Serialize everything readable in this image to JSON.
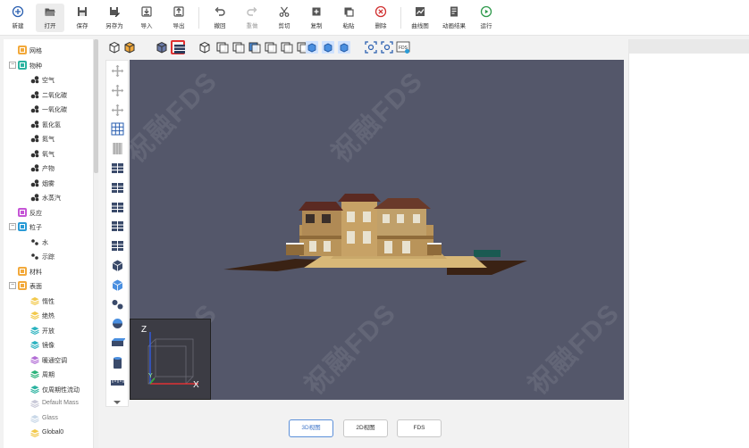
{
  "toolbar": {
    "items": [
      {
        "label": "新建",
        "icon": "plus-circle-icon"
      },
      {
        "label": "打开",
        "icon": "folder-open-icon"
      },
      {
        "label": "保存",
        "icon": "save-icon"
      },
      {
        "label": "另存为",
        "icon": "save-as-icon"
      },
      {
        "label": "导入",
        "icon": "import-icon"
      },
      {
        "label": "导出",
        "icon": "export-icon"
      },
      {
        "label": "撤回",
        "icon": "undo-icon"
      },
      {
        "label": "重做",
        "icon": "redo-icon"
      },
      {
        "label": "剪切",
        "icon": "scissors-icon"
      },
      {
        "label": "复制",
        "icon": "copy-icon"
      },
      {
        "label": "粘贴",
        "icon": "paste-icon"
      },
      {
        "label": "删除",
        "icon": "delete-icon"
      },
      {
        "label": "曲线图",
        "icon": "line-chart-icon"
      },
      {
        "label": "动画结果",
        "icon": "animation-result-icon"
      },
      {
        "label": "运行",
        "icon": "play-circle-icon"
      }
    ]
  },
  "tree": {
    "items": [
      {
        "label": "网格",
        "level": 0,
        "icon": "grid-icon",
        "color": "#f2a93b"
      },
      {
        "label": "物种",
        "level": 0,
        "icon": "species-icon",
        "color": "#2bb3a0",
        "expanded": true
      },
      {
        "label": "空气",
        "level": 1,
        "icon": "molecule-icon"
      },
      {
        "label": "二氧化碳",
        "level": 1,
        "icon": "molecule-icon"
      },
      {
        "label": "一氧化碳",
        "level": 1,
        "icon": "molecule-icon"
      },
      {
        "label": "氰化氢",
        "level": 1,
        "icon": "molecule-icon"
      },
      {
        "label": "氮气",
        "level": 1,
        "icon": "molecule-icon"
      },
      {
        "label": "氧气",
        "level": 1,
        "icon": "molecule-icon"
      },
      {
        "label": "产物",
        "level": 1,
        "icon": "molecule-icon"
      },
      {
        "label": "烟雾",
        "level": 1,
        "icon": "molecule-icon"
      },
      {
        "label": "水蒸汽",
        "level": 1,
        "icon": "molecule-icon"
      },
      {
        "label": "反应",
        "level": 0,
        "icon": "reaction-icon",
        "color": "#c555d6"
      },
      {
        "label": "粒子",
        "level": 0,
        "icon": "particle-icon",
        "color": "#2a9bd6",
        "expanded": true
      },
      {
        "label": "水",
        "level": 1,
        "icon": "particle-dot-icon"
      },
      {
        "label": "示踪",
        "level": 1,
        "icon": "particle-dot-icon"
      },
      {
        "label": "材料",
        "level": 0,
        "icon": "material-icon",
        "color": "#f2a93b"
      },
      {
        "label": "表面",
        "level": 0,
        "icon": "surface-icon",
        "color": "#f2a93b",
        "expanded": true
      },
      {
        "label": "惰性",
        "level": 1,
        "icon": "layers-icon",
        "color": "#f2c94c"
      },
      {
        "label": "绝热",
        "level": 1,
        "icon": "layers-icon",
        "color": "#f2c94c"
      },
      {
        "label": "开放",
        "level": 1,
        "icon": "layers-icon",
        "color": "#2bb3c0"
      },
      {
        "label": "镜像",
        "level": 1,
        "icon": "layers-icon",
        "color": "#2bb3c0"
      },
      {
        "label": "暖通空调",
        "level": 1,
        "icon": "layers-icon",
        "color": "#b36fd6"
      },
      {
        "label": "周期",
        "level": 1,
        "icon": "layers-icon",
        "color": "#2bb37a"
      },
      {
        "label": "仅周期性流动",
        "level": 1,
        "icon": "layers-icon",
        "color": "#2bb3a0"
      },
      {
        "label": "Default Mass",
        "level": 1,
        "icon": "layers-icon",
        "color": "#c9c9d8",
        "dim": true
      },
      {
        "label": "Glass",
        "level": 1,
        "icon": "layers-icon",
        "color": "#c9d8e8",
        "dim": true
      },
      {
        "label": "Global0",
        "level": 1,
        "icon": "layers-icon",
        "color": "#f2c94c"
      }
    ]
  },
  "viewbar": {
    "buttons": [
      "wire-cube-icon",
      "solid-cube-icon",
      "textured-cube-icon",
      "box-outline-icon",
      "cube-open-icon",
      "view-front-icon",
      "view-back-icon",
      "view-left-icon",
      "view-right-icon",
      "view-top-icon",
      "view-bottom-icon",
      "iso-view-1-icon",
      "iso-view-2-icon",
      "iso-view-3-icon",
      "zoom-fit-icon",
      "zoom-selection-icon",
      "fds-export-icon"
    ],
    "fds_label": "FDS"
  },
  "sidetools": [
    "move-icon",
    "rotate-icon",
    "mirror-icon",
    "grid-mesh-icon",
    "wall-icon",
    "obstruction-icon",
    "hole-icon",
    "vent-icon",
    "split-icon",
    "block-icon",
    "cube-icon",
    "vent-surface-icon",
    "particle-cloud-icon",
    "sphere-cut-icon",
    "slab-icon",
    "cylinder-icon",
    "ruler-icon"
  ],
  "viewport": {
    "watermark": "祝融FDS",
    "axes": {
      "z": "Z",
      "y": "Y",
      "x": "X"
    }
  },
  "view_tabs": [
    {
      "label": "3D视图",
      "active": true
    },
    {
      "label": "2D视图",
      "active": false
    },
    {
      "label": "FDS",
      "active": false
    }
  ],
  "colors": {
    "accent": "#3d74c8",
    "viewport_bg": "#54576a",
    "highlight": "#e03030"
  }
}
